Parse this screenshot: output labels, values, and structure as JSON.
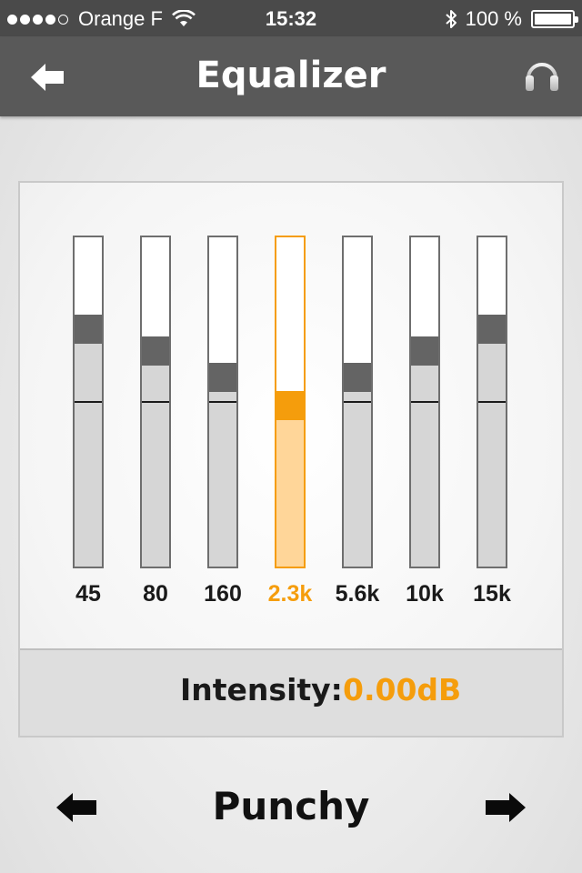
{
  "status_bar": {
    "signal_strength": 4,
    "carrier": "Orange F",
    "time": "15:32",
    "battery_percent": "100 %"
  },
  "nav": {
    "title": "Equalizer",
    "back_icon": "back-arrow-icon",
    "headphones_icon": "headphones-icon"
  },
  "equalizer": {
    "bands": [
      {
        "label": "45",
        "gain_level": 0.72,
        "active": false
      },
      {
        "label": "80",
        "gain_level": 0.655,
        "active": false
      },
      {
        "label": "160",
        "gain_level": 0.575,
        "active": false
      },
      {
        "label": "2.3k",
        "gain_level": 0.49,
        "active": true
      },
      {
        "label": "5.6k",
        "gain_level": 0.575,
        "active": false
      },
      {
        "label": "10k",
        "gain_level": 0.655,
        "active": false
      },
      {
        "label": "15k",
        "gain_level": 0.72,
        "active": false
      }
    ],
    "zero_level": 0.5,
    "intensity_label": "Intensity:",
    "intensity_value": "0.00dB"
  },
  "preset": {
    "name": "Punchy",
    "prev_icon": "prev-arrow-icon",
    "next_icon": "next-arrow-icon"
  },
  "colors": {
    "accent": "#f59d0c",
    "accent_light": "#ffd699",
    "bar_header": "#595959",
    "status_bar": "#4a4a4a"
  }
}
